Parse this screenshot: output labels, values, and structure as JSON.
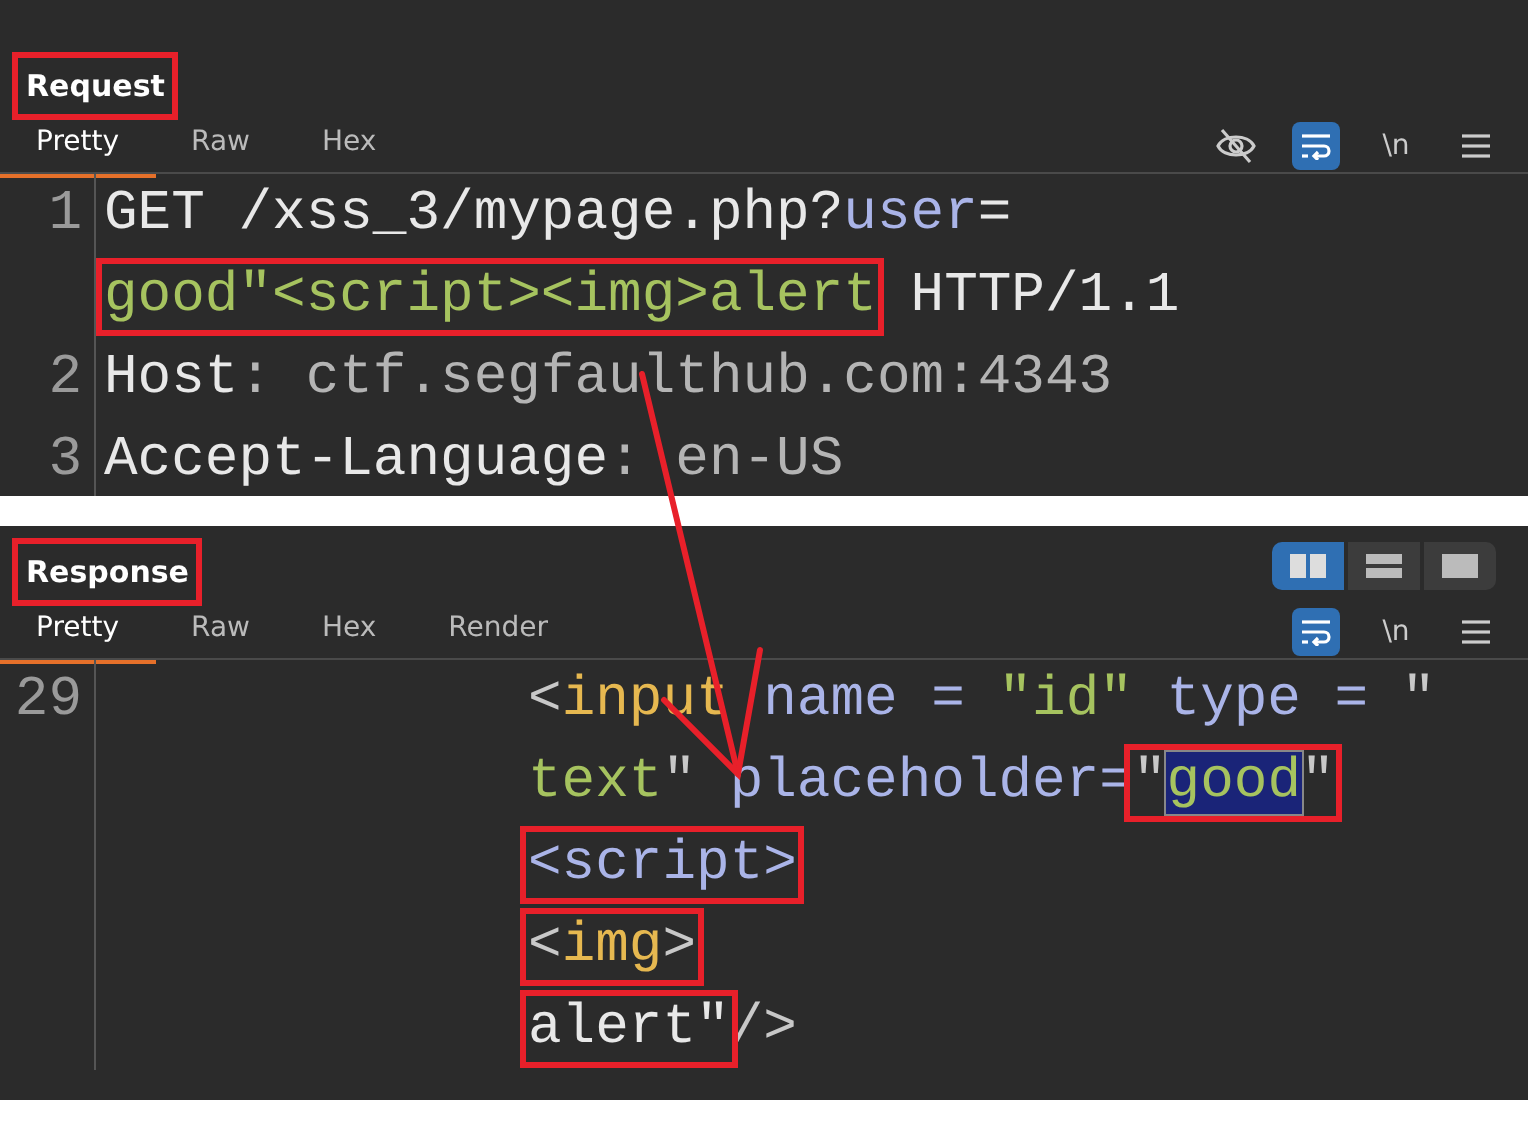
{
  "request": {
    "title": "Request",
    "title_annotated": true,
    "tabs": [
      {
        "label": "Pretty",
        "selected": true
      },
      {
        "label": "Raw",
        "selected": false
      },
      {
        "label": "Hex",
        "selected": false
      }
    ],
    "tools": [
      {
        "kind": "hide"
      },
      {
        "kind": "wrap",
        "on": true
      },
      {
        "kind": "text",
        "text": "\\n"
      },
      {
        "kind": "menu"
      }
    ],
    "lines": [
      {
        "number": "1",
        "segments": [
          {
            "kind": "plain",
            "text": "GET /xss_3/mypage.php?"
          },
          {
            "kind": "attr",
            "text": "user"
          },
          {
            "kind": "plain",
            "text": "="
          }
        ]
      },
      {
        "segments": [
          {
            "kind": "boxed",
            "parts": [
              {
                "kind": "value",
                "text": "good\"<script><img>alert"
              }
            ]
          },
          {
            "kind": "plain",
            "text": " HTTP/1.1"
          }
        ]
      },
      {
        "number": "2",
        "segments": [
          {
            "kind": "plain",
            "text": "Host"
          },
          {
            "kind": "muted",
            "text": ": ctf.segfaulthub.com:4343"
          }
        ]
      },
      {
        "number": "3",
        "segments": [
          {
            "kind": "plain",
            "text": "Accept-Language"
          },
          {
            "kind": "muted",
            "text": ": en-US"
          }
        ]
      }
    ]
  },
  "response": {
    "title": "Response",
    "title_annotated": true,
    "view_modes": [
      {
        "kind": "columns",
        "selected": true
      },
      {
        "kind": "rows",
        "selected": false
      },
      {
        "kind": "single",
        "selected": false
      }
    ],
    "tabs": [
      {
        "label": "Pretty",
        "selected": true
      },
      {
        "label": "Raw",
        "selected": false
      },
      {
        "label": "Hex",
        "selected": false
      },
      {
        "label": "Render",
        "selected": false
      }
    ],
    "tools": [
      {
        "kind": "wrap",
        "on": true
      },
      {
        "kind": "text",
        "text": "\\n"
      },
      {
        "kind": "menu"
      }
    ],
    "lines": [
      {
        "number": "29",
        "segments": [
          {
            "kind": "punct",
            "text": "<"
          },
          {
            "kind": "tag",
            "text": "input"
          },
          {
            "kind": "attr",
            "text": " name = "
          },
          {
            "kind": "value",
            "text": "\"id\""
          },
          {
            "kind": "attr",
            "text": " type = "
          },
          {
            "kind": "punct",
            "text": "\""
          }
        ]
      },
      {
        "segments": [
          {
            "kind": "value",
            "text": "text"
          },
          {
            "kind": "punct",
            "text": "\" "
          },
          {
            "kind": "attr",
            "text": "placeholder="
          },
          {
            "kind": "boxed",
            "parts": [
              {
                "kind": "punct",
                "text": "\""
              },
              {
                "kind": "value",
                "text": "good",
                "selected": true
              },
              {
                "kind": "punct",
                "text": "\""
              }
            ]
          }
        ]
      },
      {
        "segments": [
          {
            "kind": "boxed",
            "parts": [
              {
                "kind": "attr",
                "text": "<script>"
              }
            ]
          }
        ]
      },
      {
        "segments": [
          {
            "kind": "boxed",
            "parts": [
              {
                "kind": "punct",
                "text": "<"
              },
              {
                "kind": "tag",
                "text": "img"
              },
              {
                "kind": "punct",
                "text": ">"
              }
            ]
          }
        ]
      },
      {
        "segments": [
          {
            "kind": "boxed",
            "parts": [
              {
                "kind": "plain",
                "text": "alert\""
              }
            ]
          },
          {
            "kind": "punct",
            "text": "/>"
          }
        ]
      }
    ]
  }
}
